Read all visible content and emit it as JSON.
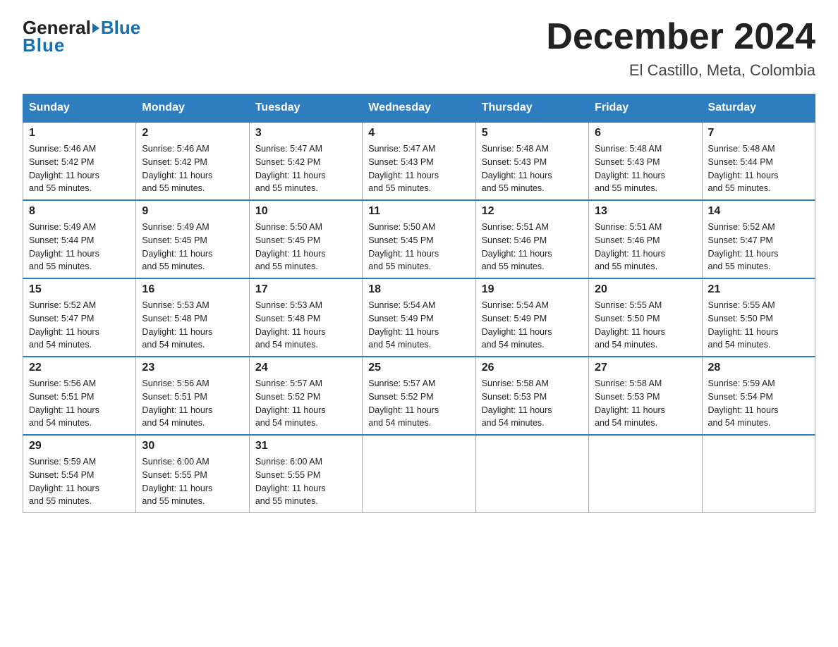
{
  "header": {
    "logo_general": "General",
    "logo_blue": "Blue",
    "title": "December 2024",
    "subtitle": "El Castillo, Meta, Colombia"
  },
  "days_of_week": [
    "Sunday",
    "Monday",
    "Tuesday",
    "Wednesday",
    "Thursday",
    "Friday",
    "Saturday"
  ],
  "weeks": [
    [
      {
        "day": "1",
        "sunrise": "5:46 AM",
        "sunset": "5:42 PM",
        "daylight": "11 hours and 55 minutes."
      },
      {
        "day": "2",
        "sunrise": "5:46 AM",
        "sunset": "5:42 PM",
        "daylight": "11 hours and 55 minutes."
      },
      {
        "day": "3",
        "sunrise": "5:47 AM",
        "sunset": "5:42 PM",
        "daylight": "11 hours and 55 minutes."
      },
      {
        "day": "4",
        "sunrise": "5:47 AM",
        "sunset": "5:43 PM",
        "daylight": "11 hours and 55 minutes."
      },
      {
        "day": "5",
        "sunrise": "5:48 AM",
        "sunset": "5:43 PM",
        "daylight": "11 hours and 55 minutes."
      },
      {
        "day": "6",
        "sunrise": "5:48 AM",
        "sunset": "5:43 PM",
        "daylight": "11 hours and 55 minutes."
      },
      {
        "day": "7",
        "sunrise": "5:48 AM",
        "sunset": "5:44 PM",
        "daylight": "11 hours and 55 minutes."
      }
    ],
    [
      {
        "day": "8",
        "sunrise": "5:49 AM",
        "sunset": "5:44 PM",
        "daylight": "11 hours and 55 minutes."
      },
      {
        "day": "9",
        "sunrise": "5:49 AM",
        "sunset": "5:45 PM",
        "daylight": "11 hours and 55 minutes."
      },
      {
        "day": "10",
        "sunrise": "5:50 AM",
        "sunset": "5:45 PM",
        "daylight": "11 hours and 55 minutes."
      },
      {
        "day": "11",
        "sunrise": "5:50 AM",
        "sunset": "5:45 PM",
        "daylight": "11 hours and 55 minutes."
      },
      {
        "day": "12",
        "sunrise": "5:51 AM",
        "sunset": "5:46 PM",
        "daylight": "11 hours and 55 minutes."
      },
      {
        "day": "13",
        "sunrise": "5:51 AM",
        "sunset": "5:46 PM",
        "daylight": "11 hours and 55 minutes."
      },
      {
        "day": "14",
        "sunrise": "5:52 AM",
        "sunset": "5:47 PM",
        "daylight": "11 hours and 55 minutes."
      }
    ],
    [
      {
        "day": "15",
        "sunrise": "5:52 AM",
        "sunset": "5:47 PM",
        "daylight": "11 hours and 54 minutes."
      },
      {
        "day": "16",
        "sunrise": "5:53 AM",
        "sunset": "5:48 PM",
        "daylight": "11 hours and 54 minutes."
      },
      {
        "day": "17",
        "sunrise": "5:53 AM",
        "sunset": "5:48 PM",
        "daylight": "11 hours and 54 minutes."
      },
      {
        "day": "18",
        "sunrise": "5:54 AM",
        "sunset": "5:49 PM",
        "daylight": "11 hours and 54 minutes."
      },
      {
        "day": "19",
        "sunrise": "5:54 AM",
        "sunset": "5:49 PM",
        "daylight": "11 hours and 54 minutes."
      },
      {
        "day": "20",
        "sunrise": "5:55 AM",
        "sunset": "5:50 PM",
        "daylight": "11 hours and 54 minutes."
      },
      {
        "day": "21",
        "sunrise": "5:55 AM",
        "sunset": "5:50 PM",
        "daylight": "11 hours and 54 minutes."
      }
    ],
    [
      {
        "day": "22",
        "sunrise": "5:56 AM",
        "sunset": "5:51 PM",
        "daylight": "11 hours and 54 minutes."
      },
      {
        "day": "23",
        "sunrise": "5:56 AM",
        "sunset": "5:51 PM",
        "daylight": "11 hours and 54 minutes."
      },
      {
        "day": "24",
        "sunrise": "5:57 AM",
        "sunset": "5:52 PM",
        "daylight": "11 hours and 54 minutes."
      },
      {
        "day": "25",
        "sunrise": "5:57 AM",
        "sunset": "5:52 PM",
        "daylight": "11 hours and 54 minutes."
      },
      {
        "day": "26",
        "sunrise": "5:58 AM",
        "sunset": "5:53 PM",
        "daylight": "11 hours and 54 minutes."
      },
      {
        "day": "27",
        "sunrise": "5:58 AM",
        "sunset": "5:53 PM",
        "daylight": "11 hours and 54 minutes."
      },
      {
        "day": "28",
        "sunrise": "5:59 AM",
        "sunset": "5:54 PM",
        "daylight": "11 hours and 54 minutes."
      }
    ],
    [
      {
        "day": "29",
        "sunrise": "5:59 AM",
        "sunset": "5:54 PM",
        "daylight": "11 hours and 55 minutes."
      },
      {
        "day": "30",
        "sunrise": "6:00 AM",
        "sunset": "5:55 PM",
        "daylight": "11 hours and 55 minutes."
      },
      {
        "day": "31",
        "sunrise": "6:00 AM",
        "sunset": "5:55 PM",
        "daylight": "11 hours and 55 minutes."
      },
      null,
      null,
      null,
      null
    ]
  ],
  "labels": {
    "sunrise": "Sunrise:",
    "sunset": "Sunset:",
    "daylight": "Daylight:"
  }
}
